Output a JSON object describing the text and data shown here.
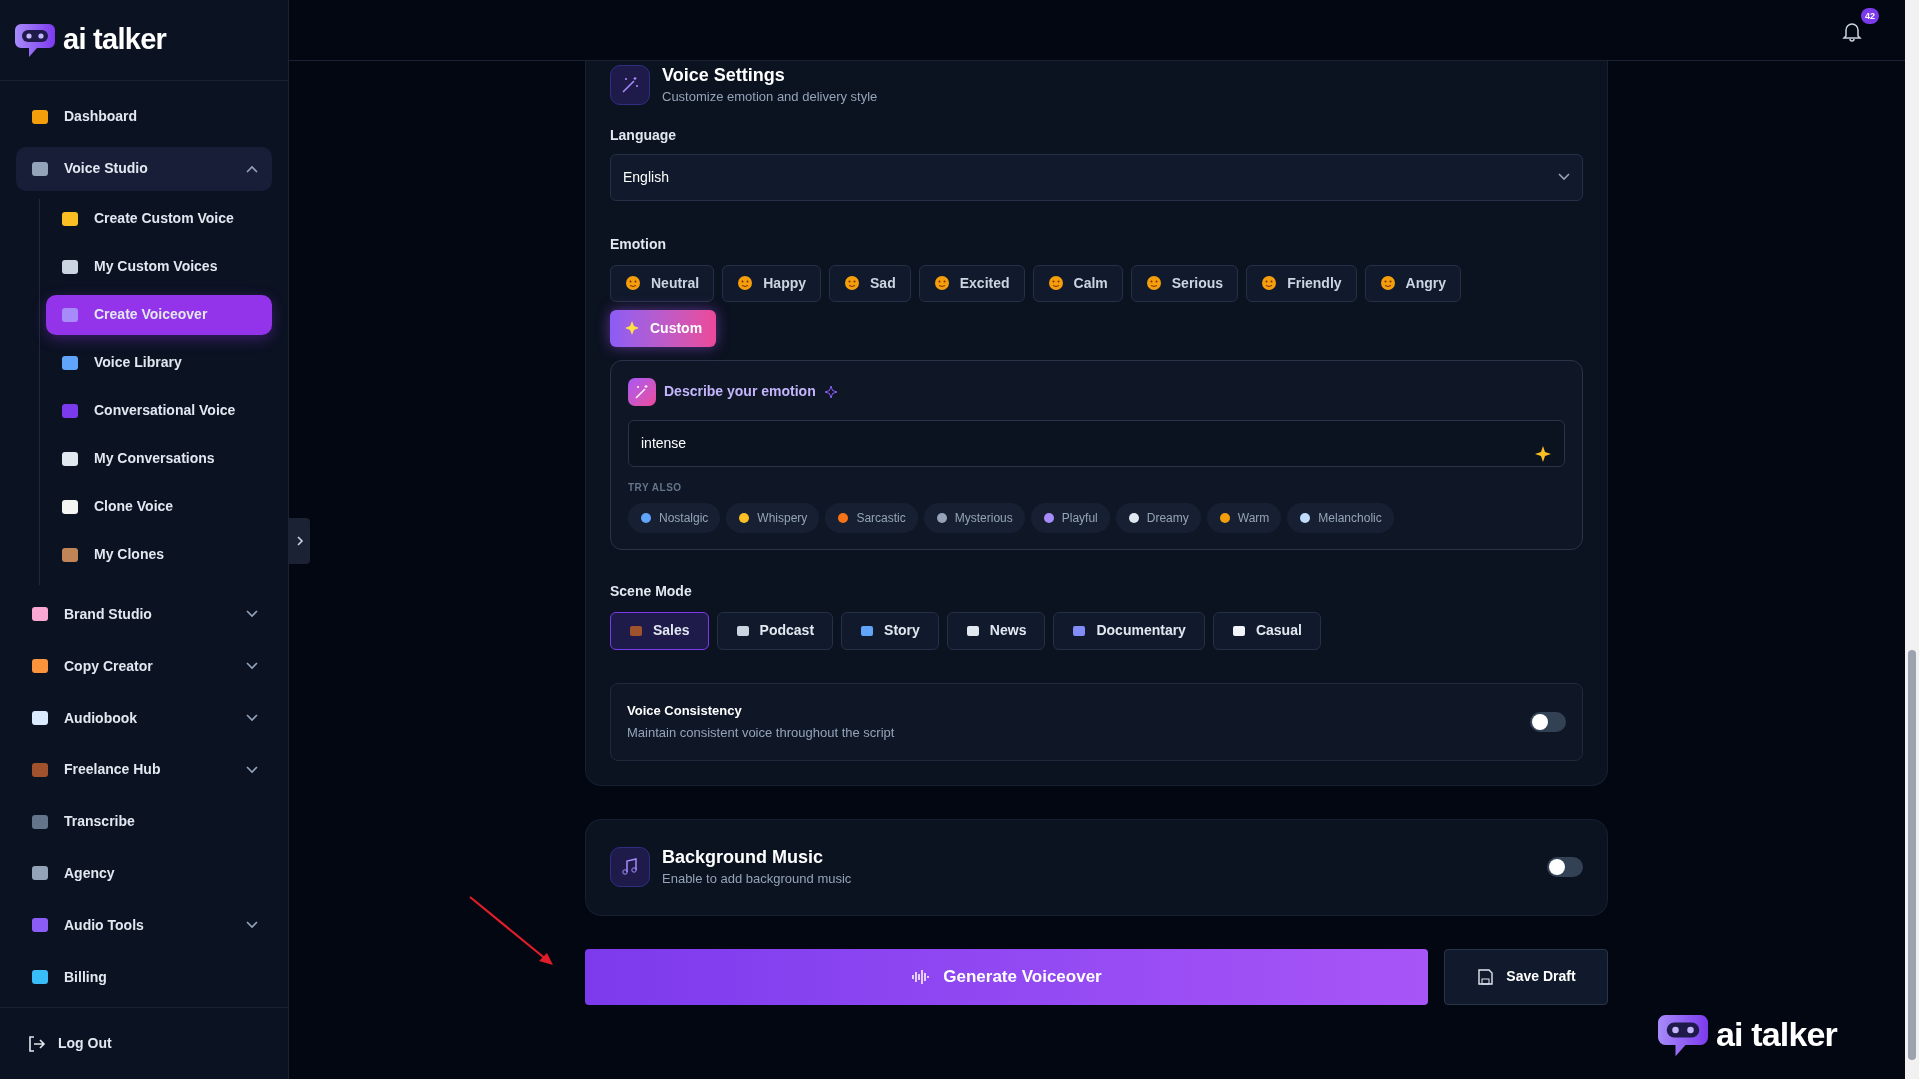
{
  "brand": {
    "name": "ai talker"
  },
  "sidebar": {
    "items": [
      {
        "label": "Dashboard",
        "kind": "link",
        "selected": false
      },
      {
        "label": "Voice Studio",
        "kind": "group",
        "expanded": true,
        "selected": false,
        "children": [
          {
            "label": "Create Custom Voice",
            "selected": false
          },
          {
            "label": "My Custom Voices",
            "selected": false
          },
          {
            "label": "Create Voiceover",
            "selected": true
          },
          {
            "label": "Voice Library",
            "selected": false
          },
          {
            "label": "Conversational Voice",
            "selected": false
          },
          {
            "label": "My Conversations",
            "selected": false
          },
          {
            "label": "Clone Voice",
            "selected": false
          },
          {
            "label": "My Clones",
            "selected": false
          }
        ]
      },
      {
        "label": "Brand Studio",
        "kind": "group",
        "expanded": false,
        "selected": false
      },
      {
        "label": "Copy Creator",
        "kind": "group",
        "expanded": false,
        "selected": false
      },
      {
        "label": "Audiobook",
        "kind": "group",
        "expanded": false,
        "selected": false
      },
      {
        "label": "Freelance Hub",
        "kind": "group",
        "expanded": false,
        "selected": false
      },
      {
        "label": "Transcribe",
        "kind": "link",
        "selected": false
      },
      {
        "label": "Agency",
        "kind": "link",
        "selected": false
      },
      {
        "label": "Audio Tools",
        "kind": "group",
        "expanded": false,
        "selected": false
      },
      {
        "label": "Billing",
        "kind": "link",
        "selected": false
      }
    ],
    "logout": "Log Out"
  },
  "header": {
    "notification_count": "42"
  },
  "voice_settings": {
    "title": "Voice Settings",
    "subtitle": "Customize emotion and delivery style",
    "language": {
      "label": "Language",
      "value": "English"
    },
    "emotion": {
      "label": "Emotion",
      "options": [
        {
          "label": "Neutral",
          "selected": false
        },
        {
          "label": "Happy",
          "selected": false
        },
        {
          "label": "Sad",
          "selected": false
        },
        {
          "label": "Excited",
          "selected": false
        },
        {
          "label": "Calm",
          "selected": false
        },
        {
          "label": "Serious",
          "selected": false
        },
        {
          "label": "Friendly",
          "selected": false
        },
        {
          "label": "Angry",
          "selected": false
        },
        {
          "label": "Custom",
          "selected": true
        }
      ]
    },
    "custom_emotion": {
      "title": "Describe your emotion",
      "value": "intense",
      "try_also_label": "TRY ALSO",
      "suggestions": [
        "Nostalgic",
        "Whispery",
        "Sarcastic",
        "Mysterious",
        "Playful",
        "Dreamy",
        "Warm",
        "Melancholic"
      ]
    },
    "scene_mode": {
      "label": "Scene Mode",
      "options": [
        {
          "label": "Sales",
          "selected": true
        },
        {
          "label": "Podcast",
          "selected": false
        },
        {
          "label": "Story",
          "selected": false
        },
        {
          "label": "News",
          "selected": false
        },
        {
          "label": "Documentary",
          "selected": false
        },
        {
          "label": "Casual",
          "selected": false
        }
      ]
    },
    "voice_consistency": {
      "title": "Voice Consistency",
      "subtitle": "Maintain consistent voice throughout the script",
      "on": false
    }
  },
  "background_music": {
    "title": "Background Music",
    "subtitle": "Enable to add background music",
    "on": false
  },
  "actions": {
    "generate": "Generate Voiceover",
    "save": "Save Draft"
  },
  "overlay_logo": {
    "name": "ai talker"
  }
}
